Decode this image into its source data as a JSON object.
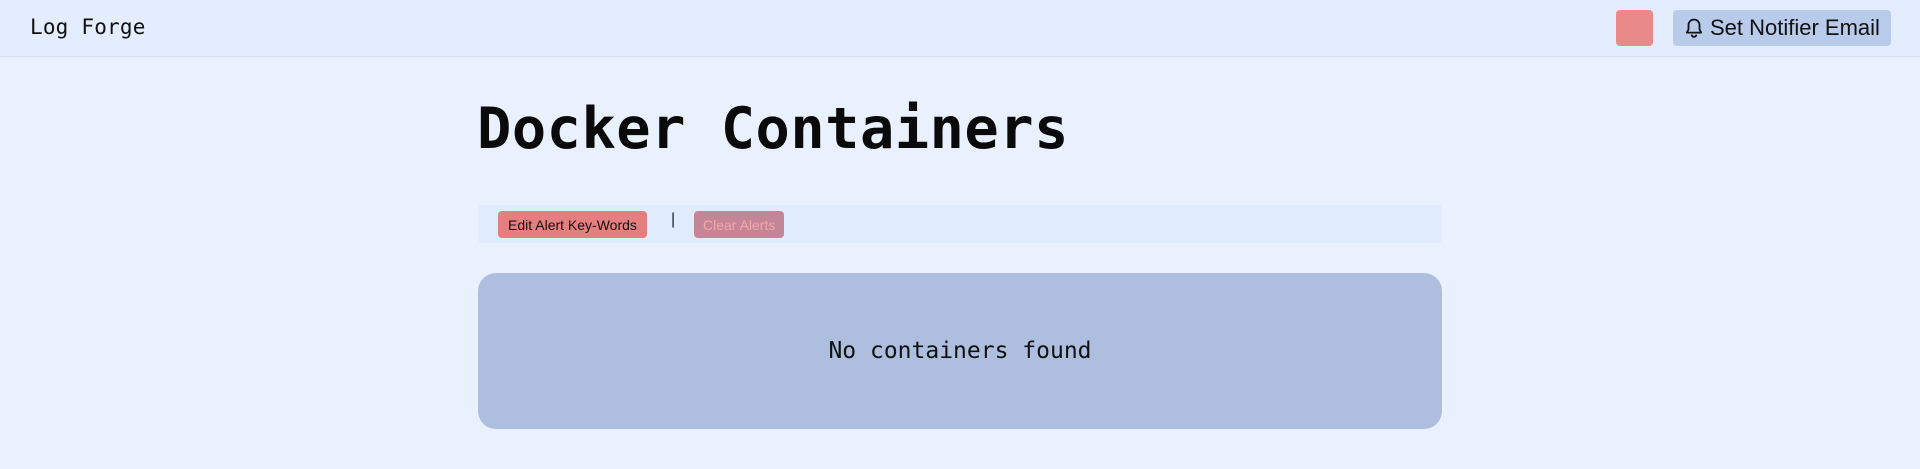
{
  "header": {
    "brand": "Log Forge",
    "status_color": "#ea8a88",
    "notifier_button": {
      "icon": "bell-icon",
      "label": "Set Notifier Email"
    }
  },
  "main": {
    "title": "Docker Containers",
    "toolbar": {
      "edit_button_label": "Edit Alert Key-Words",
      "separator": "|",
      "clear_button_label": "Clear Alerts"
    },
    "empty_state": "No containers found"
  },
  "colors": {
    "background": "#eaf1fe",
    "header_bg": "#e3edfd",
    "panel_bg": "#adbede",
    "edit_button_bg": "#e57f7f",
    "clear_button_bg": "#c48596",
    "notifier_button_bg": "#b9cbea"
  }
}
